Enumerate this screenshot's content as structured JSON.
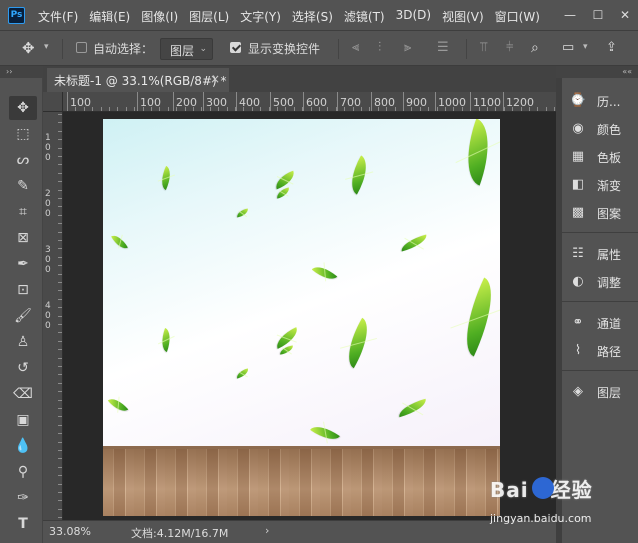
{
  "app": {
    "logo": "Ps"
  },
  "menu": [
    "文件(F)",
    "编辑(E)",
    "图像(I)",
    "图层(L)",
    "文字(Y)",
    "选择(S)",
    "滤镜(T)",
    "3D(D)",
    "视图(V)",
    "窗口(W)"
  ],
  "window_controls": {
    "minimize": "—",
    "maximize": "☐",
    "close": "✕"
  },
  "options": {
    "auto_select_label": "自动选择：",
    "auto_select_checked": false,
    "layer_target": "图层",
    "show_transform_label": "显示变换控件",
    "show_transform_checked": true
  },
  "document_tab": {
    "title": "未标题-1 @ 33.1%(RGB/8#) *",
    "close": "×"
  },
  "collapse_left": "››",
  "collapse_right": "««",
  "ruler_h": [
    "100",
    "100",
    "200",
    "300",
    "400",
    "500",
    "600",
    "700",
    "800",
    "900",
    "1000",
    "1100",
    "1200"
  ],
  "ruler_v": [
    "1",
    "0",
    "0",
    "2",
    "0",
    "0",
    "3",
    "0",
    "0",
    "4",
    "0",
    "0"
  ],
  "tools": [
    "move-tool",
    "marquee-tool",
    "lasso-tool",
    "quick-select-tool",
    "crop-tool",
    "frame-tool",
    "eyedropper-tool",
    "healing-tool",
    "brush-tool",
    "clone-stamp-tool",
    "history-brush-tool",
    "eraser-tool",
    "gradient-tool",
    "blur-tool",
    "dodge-tool",
    "pen-tool",
    "type-tool"
  ],
  "panels": [
    {
      "icon": "history-icon",
      "label": "历..."
    },
    {
      "icon": "color-icon",
      "label": "颜色"
    },
    {
      "icon": "swatches-icon",
      "label": "色板"
    },
    {
      "icon": "gradients-icon",
      "label": "渐变"
    },
    {
      "icon": "patterns-icon",
      "label": "图案"
    },
    {
      "icon": "properties-icon",
      "label": "属性"
    },
    {
      "icon": "adjustments-icon",
      "label": "调整"
    },
    {
      "icon": "channels-icon",
      "label": "通道"
    },
    {
      "icon": "paths-icon",
      "label": "路径"
    },
    {
      "icon": "layers-icon",
      "label": "图层"
    }
  ],
  "status": {
    "zoom": "33.08%",
    "doc_label": "文档:4.12M/16.7M",
    "arrow": "›"
  },
  "watermark": {
    "brand": "Bai",
    "brand2": "经验",
    "url": "jingyan.baidu.com"
  }
}
